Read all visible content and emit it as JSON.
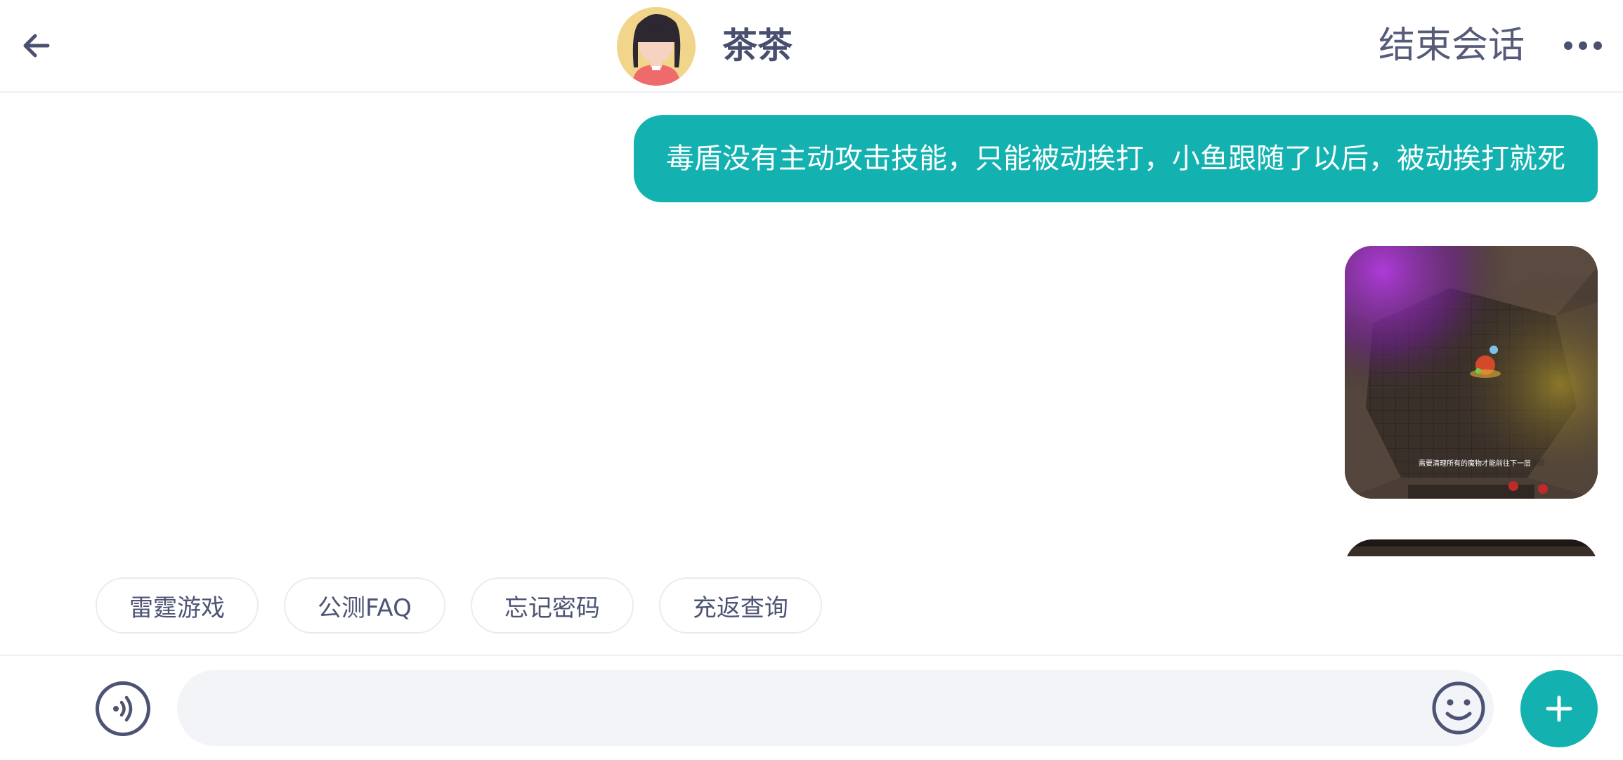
{
  "header": {
    "back_icon": "arrow-left-icon",
    "agent_name": "茶茶",
    "end_chat_label": "结束会话",
    "more_icon": "more-horizontal-icon"
  },
  "messages": [
    {
      "type": "text",
      "from": "user",
      "text": "毒盾没有主动攻击技能，只能被动挨打，小鱼跟随了以后，被动挨打就死"
    },
    {
      "type": "image",
      "from": "user",
      "caption_in_image": "需要清理所有的魔物才能前往下一层"
    },
    {
      "type": "image",
      "from": "user"
    }
  ],
  "quick_replies": [
    "雷霆游戏",
    "公测FAQ",
    "忘记密码",
    "充返查询"
  ],
  "input": {
    "voice_icon": "voice-icon",
    "value": "",
    "placeholder": "",
    "emoji_icon": "emoji-icon",
    "plus_icon": "plus-icon"
  },
  "colors": {
    "accent": "#13b2b1",
    "text_dark": "#4a5070",
    "input_bg": "#f2f4f7"
  }
}
